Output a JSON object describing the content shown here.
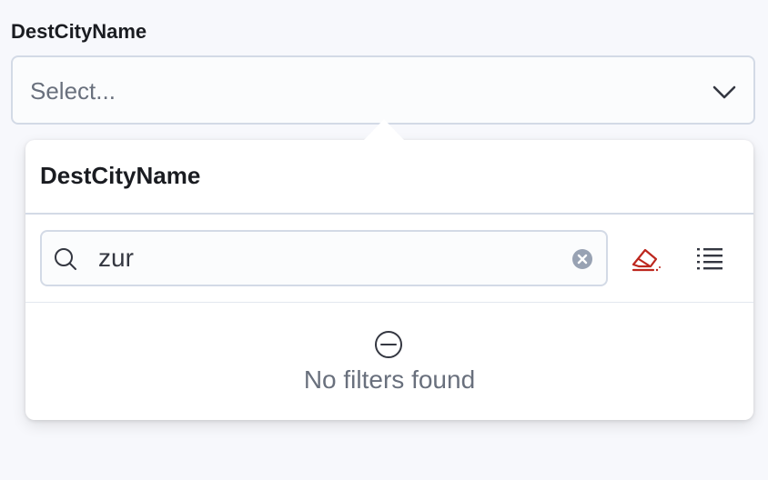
{
  "field": {
    "label": "DestCityName",
    "placeholder": "Select..."
  },
  "popover": {
    "title": "DestCityName",
    "search": {
      "value": "zur"
    },
    "empty_message": "No filters found"
  },
  "icons": {
    "chevron": "chevron-down-icon",
    "search": "search-icon",
    "clear": "clear-icon",
    "eraser": "eraser-icon",
    "list": "list-icon",
    "empty": "minus-in-circle-icon"
  },
  "colors": {
    "accent_danger": "#bd271e",
    "text_primary": "#1a1c21",
    "text_subdued": "#69707d",
    "border": "#d3dae6",
    "clear_icon": "#98a2b3"
  }
}
